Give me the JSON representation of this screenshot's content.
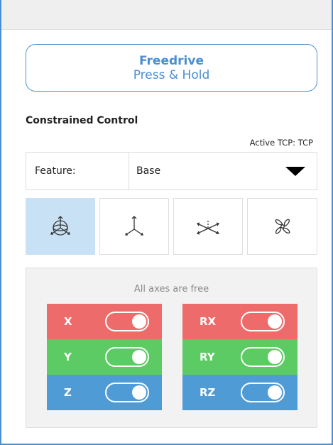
{
  "freedrive": {
    "line1": "Freedrive",
    "line2": "Press & Hold"
  },
  "constrained": {
    "title": "Constrained Control",
    "active_tcp_label": "Active TCP:",
    "active_tcp_value": "TCP"
  },
  "feature": {
    "label": "Feature:",
    "value": "Base"
  },
  "modes": [
    {
      "name": "free-mode",
      "icon": "gimbal-icon",
      "active": true
    },
    {
      "name": "translation-mode",
      "icon": "axes-3d-icon",
      "active": false
    },
    {
      "name": "plane-mode",
      "icon": "plane-axes-icon",
      "active": false
    },
    {
      "name": "rotation-mode",
      "icon": "rotation-icon",
      "active": false
    }
  ],
  "axes": {
    "caption": "All axes are free",
    "left": [
      {
        "label": "X",
        "on": true,
        "color": "#ee6b6b"
      },
      {
        "label": "Y",
        "on": true,
        "color": "#5ccb64"
      },
      {
        "label": "Z",
        "on": true,
        "color": "#4f9bd6"
      }
    ],
    "right": [
      {
        "label": "RX",
        "on": true,
        "color": "#ee6b6b"
      },
      {
        "label": "RY",
        "on": true,
        "color": "#5ccb64"
      },
      {
        "label": "RZ",
        "on": true,
        "color": "#4f9bd6"
      }
    ]
  },
  "colors": {
    "accent": "#4a8fd0",
    "active_mode_bg": "#c8e1f5"
  }
}
